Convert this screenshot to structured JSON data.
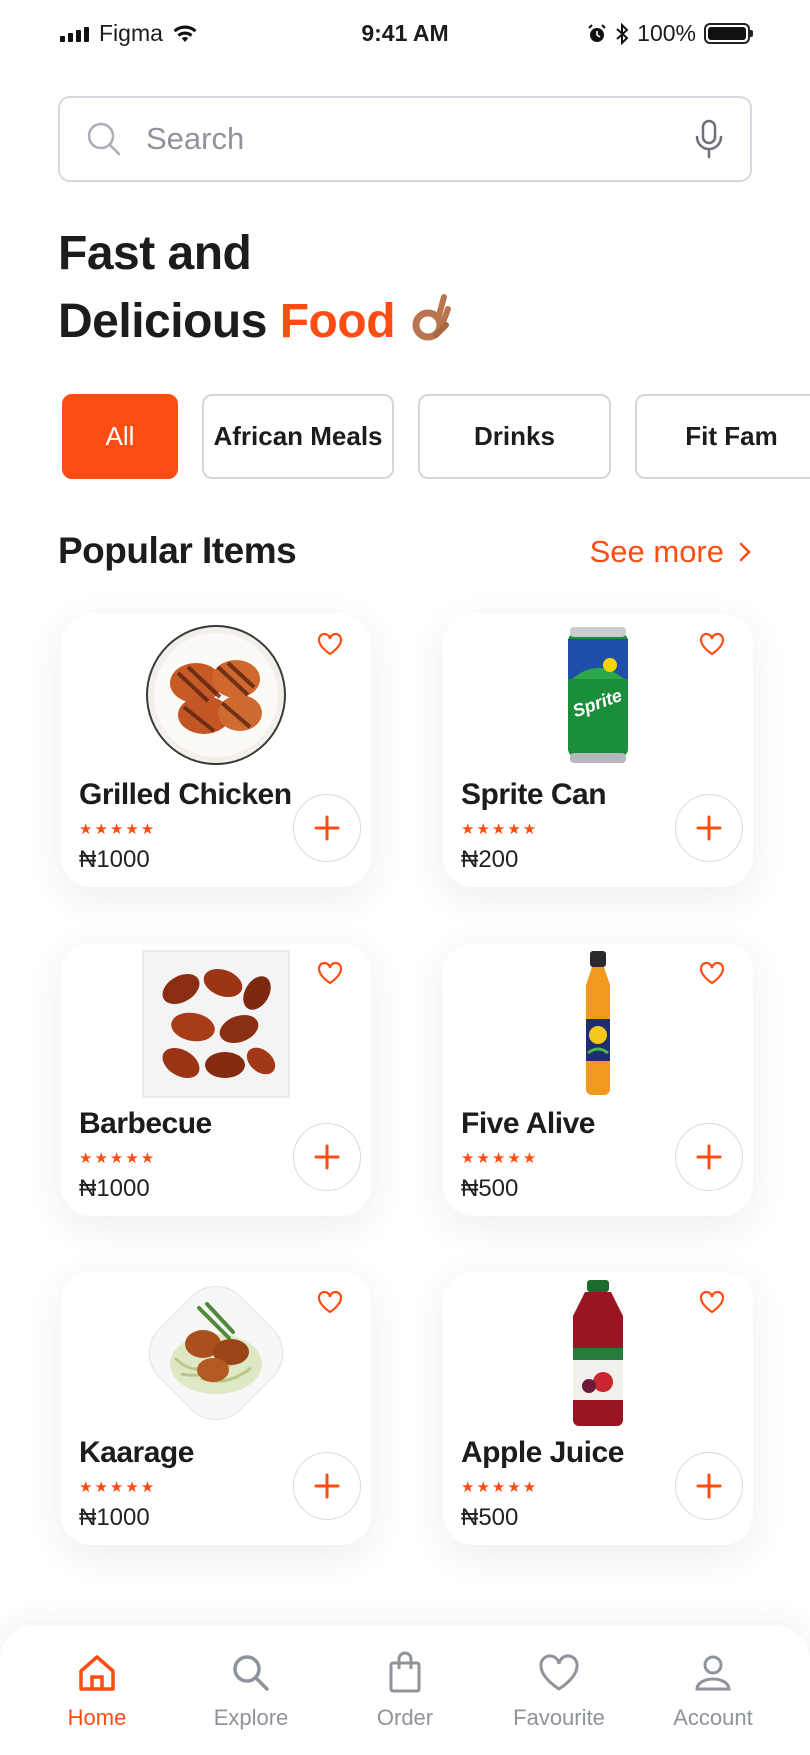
{
  "status_bar": {
    "carrier": "Figma",
    "time": "9:41 AM",
    "battery": "100%"
  },
  "search": {
    "placeholder": "Search"
  },
  "headline": {
    "line1": "Fast and",
    "line2_plain": "Delicious ",
    "line2_accent": "Food",
    "emoji_icon": "ok-hand-icon"
  },
  "categories": [
    {
      "label": "All",
      "active": true
    },
    {
      "label": "African Meals",
      "active": false
    },
    {
      "label": "Drinks",
      "active": false
    },
    {
      "label": "Fit Fam",
      "active": false
    }
  ],
  "popular": {
    "title": "Popular Items",
    "see_more": "See more"
  },
  "items": [
    {
      "name": "Grilled Chicken",
      "price": "₦1000",
      "rating": 5,
      "image": "grilled-chicken"
    },
    {
      "name": "Sprite Can",
      "price": "₦200",
      "rating": 5,
      "image": "sprite-can"
    },
    {
      "name": "Barbecue",
      "price": "₦1000",
      "rating": 5,
      "image": "barbecue-wings"
    },
    {
      "name": "Five Alive",
      "price": "₦500",
      "rating": 5,
      "image": "five-alive-bottle"
    },
    {
      "name": "Kaarage",
      "price": "₦1000",
      "rating": 5,
      "image": "kaarage-plate"
    },
    {
      "name": "Apple Juice",
      "price": "₦500",
      "rating": 5,
      "image": "apple-juice-bottle"
    }
  ],
  "nav": [
    {
      "label": "Home",
      "icon": "home-icon",
      "active": true
    },
    {
      "label": "Explore",
      "icon": "search-icon",
      "active": false
    },
    {
      "label": "Order",
      "icon": "shopping-bag-icon",
      "active": false
    },
    {
      "label": "Favourite",
      "icon": "heart-icon",
      "active": false
    },
    {
      "label": "Account",
      "icon": "user-icon",
      "active": false
    }
  ],
  "colors": {
    "accent": "#fd4d12",
    "muted": "#8f939c",
    "border": "#d4d6db"
  }
}
